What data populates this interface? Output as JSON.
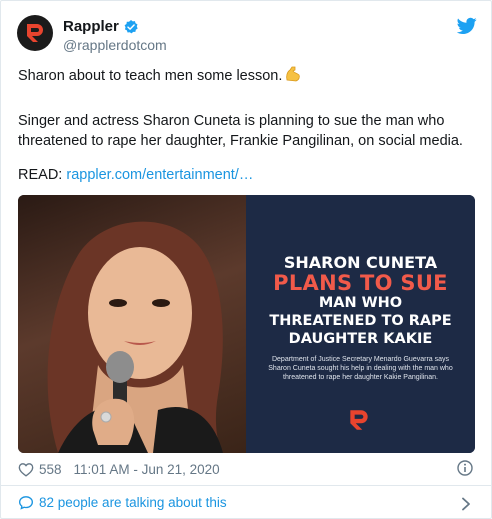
{
  "account": {
    "name": "Rappler",
    "handle": "@rapplerdotcom"
  },
  "tweet": {
    "line1": "Sharon about to teach men some lesson.",
    "line2": "Singer and actress Sharon Cuneta is planning to sue the man who threatened to rape her daughter, Frankie Pangilinan, on social media.",
    "read_label": "READ:",
    "read_link": "rappler.com/entertainment/…"
  },
  "media": {
    "headline_1": "SHARON CUNETA",
    "headline_2": "PLANS TO SUE",
    "headline_3": "MAN WHO",
    "headline_4": "THREATENED TO RAPE",
    "headline_5": "DAUGHTER KAKIE",
    "caption": "Department of Justice Secretary Menardo Guevarra says Sharon Cuneta sought his help in dealing with the man who threatened to rape her daughter Kakie Pangilinan."
  },
  "meta": {
    "likes": "558",
    "timestamp": "11:01 AM - Jun 21, 2020"
  },
  "conversation": {
    "label": "82 people are talking about this"
  },
  "colors": {
    "link": "#1b95e0",
    "panel_bg": "#1d2a45",
    "headline_red": "#f15a4a",
    "muted": "#657786"
  },
  "icons": [
    "rappler-logo-icon",
    "verified-badge-icon",
    "twitter-bird-icon",
    "flexed-biceps-emoji-icon",
    "heart-icon",
    "info-icon",
    "speech-bubble-icon",
    "chevron-right-icon"
  ]
}
